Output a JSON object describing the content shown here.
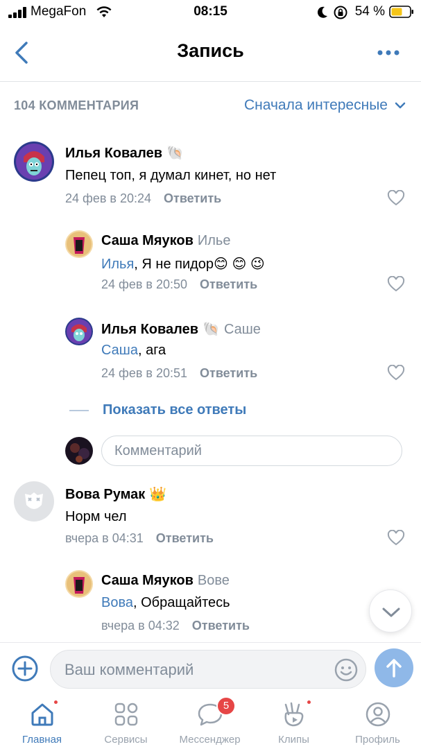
{
  "status_bar": {
    "carrier": "MegaFon",
    "time": "08:15",
    "battery": "54 %"
  },
  "header": {
    "title": "Запись"
  },
  "comments_bar": {
    "count_label": "104 КОММЕНТАРИЯ",
    "sort_label": "Сначала интересные"
  },
  "comments": [
    {
      "author": "Илья Ковалев",
      "badge_emoji": "🐚",
      "text": "Пепец топ, я думал кинет, но нет",
      "date": "24 фев в 20:24",
      "reply_label": "Ответить"
    },
    {
      "author": "Саша Мяуков",
      "reply_to": "Илье",
      "mention": "Илья",
      "text": ", Я не пидор😊 😊 😉",
      "date": "24 фев в 20:50",
      "reply_label": "Ответить"
    },
    {
      "author": "Илья Ковалев",
      "badge_emoji": "🐚",
      "reply_to": "Саше",
      "mention": "Саша",
      "text": ", ага",
      "date": "24 фев в 20:51",
      "reply_label": "Ответить"
    },
    {
      "author": "Вова Румак",
      "badge_emoji": "👑",
      "text": "Норм чел",
      "date": "вчера в 04:31",
      "reply_label": "Ответить"
    },
    {
      "author": "Саша Мяуков",
      "reply_to": "Вове",
      "mention": "Вова",
      "text": ", Обращайтесь",
      "date": "вчера в 04:32",
      "reply_label": "Ответить"
    }
  ],
  "show_all_replies": "Показать все ответы",
  "inline_reply_placeholder": "Комментарий",
  "composer": {
    "placeholder": "Ваш комментарий"
  },
  "tabbar": {
    "tabs": [
      {
        "label": "Главная",
        "active": true,
        "dot": true
      },
      {
        "label": "Сервисы",
        "active": false
      },
      {
        "label": "Мессенджер",
        "active": false,
        "badge": "5"
      },
      {
        "label": "Клипы",
        "active": false,
        "dot": true
      },
      {
        "label": "Профиль",
        "active": false
      }
    ]
  },
  "colors": {
    "accent": "#3f7ab9",
    "secondary_text": "#818c99",
    "badge_red": "#e64646",
    "send_button": "#8fb8e8"
  },
  "icons": [
    "signal-icon",
    "wifi-icon",
    "moon-icon",
    "rotation-lock-icon",
    "battery-icon",
    "back-icon",
    "more-icon",
    "chevron-down-icon",
    "heart-icon",
    "plus-icon",
    "smile-icon",
    "send-icon",
    "home-icon",
    "services-icon",
    "messenger-icon",
    "clips-icon",
    "profile-icon"
  ]
}
